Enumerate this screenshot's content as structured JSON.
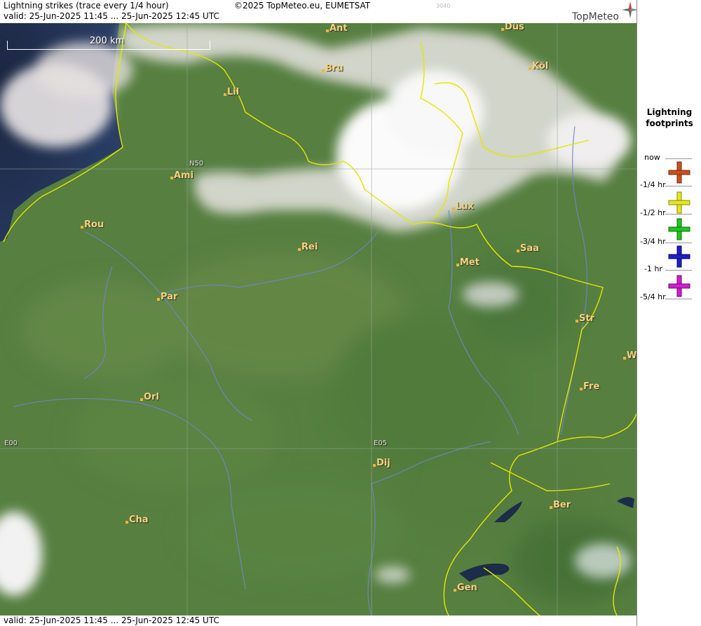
{
  "header": {
    "title": "Lightning strikes (trace every 1/4 hour)",
    "valid": "valid:  25-Jun-2025 11:45 ... 25-Jun-2025 12:45 UTC",
    "copyright": "©2025 TopMeteo.eu, EUMETSAT",
    "code": "3040",
    "logo": "TopMeteo"
  },
  "footer": {
    "valid": "valid:  25-Jun-2025 11:45 ... 25-Jun-2025 12:45 UTC"
  },
  "scale": {
    "label": "200 km"
  },
  "grid_labels": {
    "lat": "N50",
    "lon0": "E00",
    "lon5": "E05"
  },
  "cities": [
    "Ant",
    "Düs",
    "Bru",
    "Köl",
    "Lil",
    "Ami",
    "Lux",
    "Rou",
    "Rei",
    "Saa",
    "Met",
    "Par",
    "Str",
    "W",
    "Fre",
    "Orl",
    "Dij",
    "Ber",
    "Cha",
    "Gen"
  ],
  "legend": {
    "title_line1": "Lightning",
    "title_line2": "footprints",
    "entries": [
      {
        "label": "now",
        "color": ""
      },
      {
        "label": "-1/4 hr",
        "color": "#c8501e"
      },
      {
        "label": "-1/2 hr",
        "color": "#e6e61e"
      },
      {
        "label": "-3/4 hr",
        "color": "#1ec81e"
      },
      {
        "label": "-1 hr",
        "color": "#1e1ec8"
      },
      {
        "label": "-5/4 hr",
        "color": "#d21ed2"
      }
    ]
  }
}
